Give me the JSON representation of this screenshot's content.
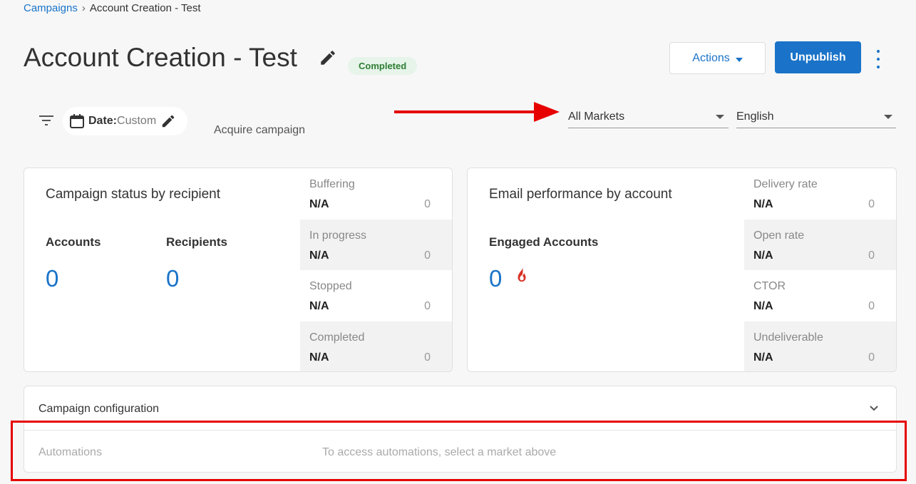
{
  "breadcrumb": {
    "root": "Campaigns",
    "separator": "›",
    "current": "Account Creation - Test"
  },
  "header": {
    "title": "Account Creation - Test",
    "status": "Completed",
    "actions_label": "Actions",
    "unpublish_label": "Unpublish",
    "status_color": "#2e7d32",
    "accent_color": "#1a73c8"
  },
  "filters": {
    "date_label": "Date:",
    "date_value": "Custom",
    "campaign_type": "Acquire campaign",
    "market": "All Markets",
    "language": "English"
  },
  "status_card": {
    "title": "Campaign status by recipient",
    "accounts_label": "Accounts",
    "accounts_value": "0",
    "recipients_label": "Recipients",
    "recipients_value": "0",
    "rows": [
      {
        "label": "Buffering",
        "value": "N/A",
        "count": "0"
      },
      {
        "label": "In progress",
        "value": "N/A",
        "count": "0"
      },
      {
        "label": "Stopped",
        "value": "N/A",
        "count": "0"
      },
      {
        "label": "Completed",
        "value": "N/A",
        "count": "0"
      }
    ]
  },
  "email_card": {
    "title": "Email performance by account",
    "engaged_label": "Engaged Accounts",
    "engaged_value": "0",
    "rows": [
      {
        "label": "Delivery rate",
        "value": "N/A",
        "count": "0"
      },
      {
        "label": "Open rate",
        "value": "N/A",
        "count": "0"
      },
      {
        "label": "CTOR",
        "value": "N/A",
        "count": "0"
      },
      {
        "label": "Undeliverable",
        "value": "N/A",
        "count": "0"
      }
    ]
  },
  "config": {
    "title": "Campaign configuration",
    "automations_label": "Automations",
    "automations_message": "To access automations, select a market above"
  },
  "annotation_color": "#e60000"
}
